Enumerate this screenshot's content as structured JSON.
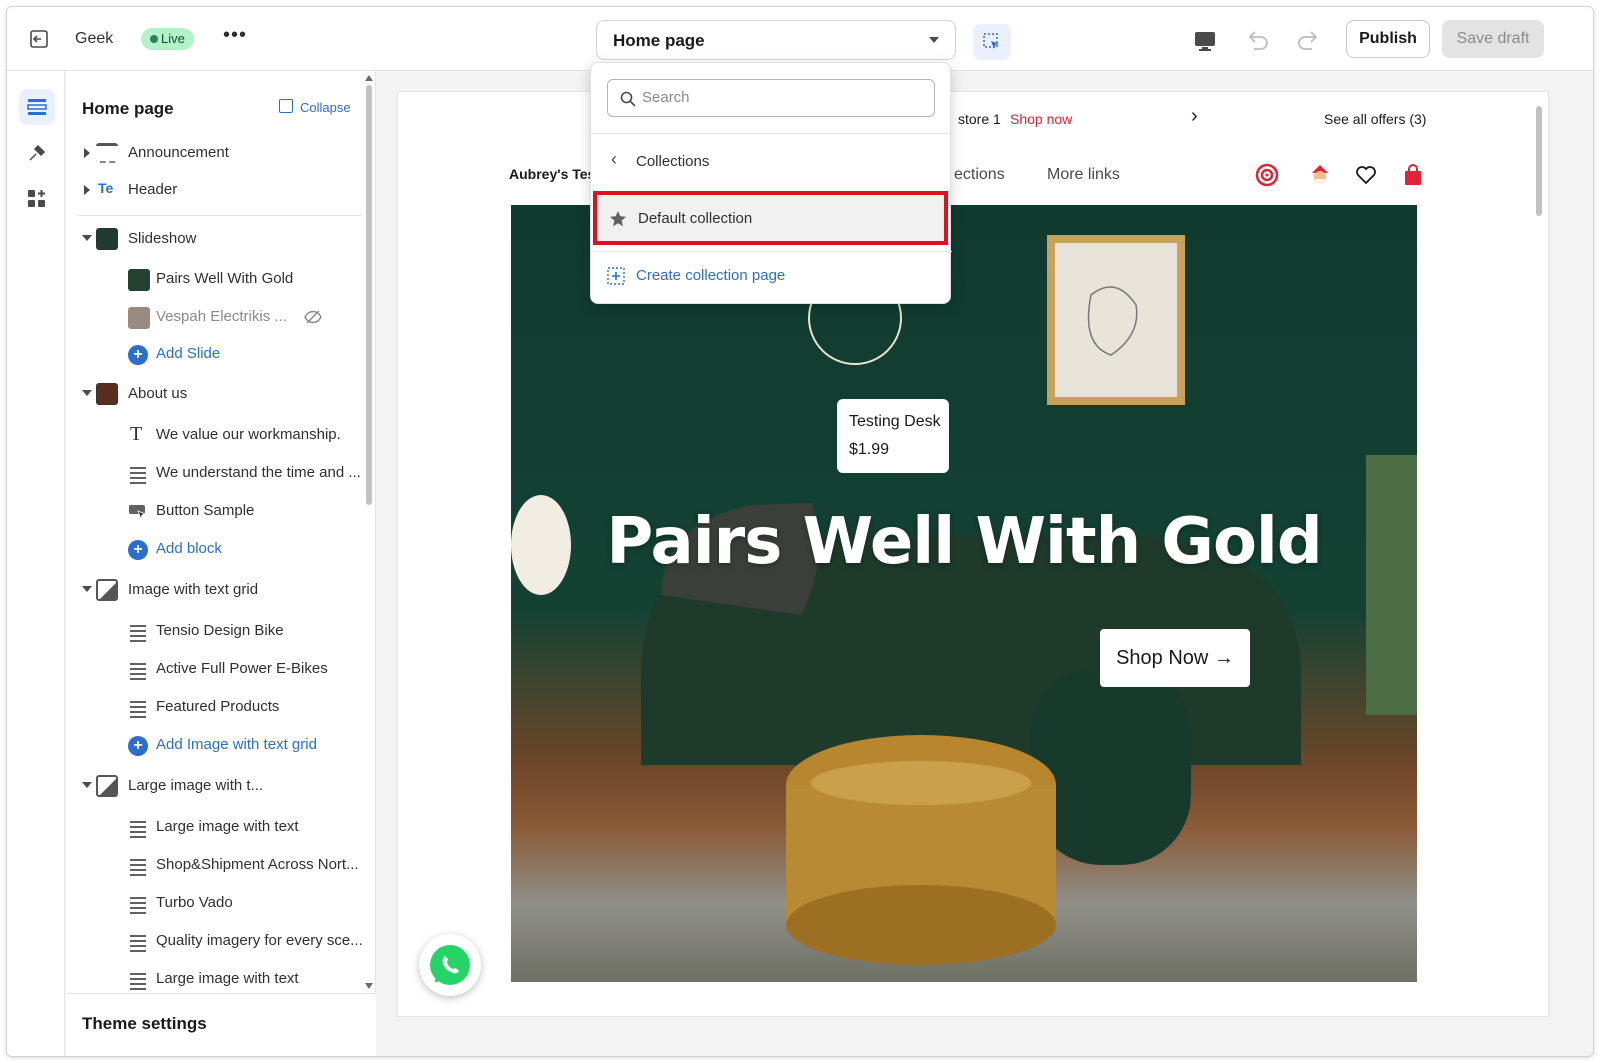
{
  "topbar": {
    "store_name": "Geek",
    "status_badge": "Live",
    "more_label": "•••",
    "page_selector": "Home page",
    "publish_label": "Publish",
    "save_draft_label": "Save draft"
  },
  "sidebar": {
    "title": "Home page",
    "collapse_label": "Collapse",
    "sections": [
      {
        "label": "Announcement"
      },
      {
        "label": "Header"
      },
      {
        "label": "Slideshow",
        "children": [
          "Pairs Well With Gold",
          "Vespah Electrikis ...",
          "Add Slide"
        ]
      },
      {
        "label": "About us",
        "children": [
          "We value our workmanship.",
          "We understand the time and ...",
          "Button Sample",
          "Add block"
        ]
      },
      {
        "label": "Image with text grid",
        "children": [
          "Tensio Design Bike",
          "Active Full Power E-Bikes",
          "Featured Products",
          "Add Image with text grid"
        ]
      },
      {
        "label": "Large image with t...",
        "children": [
          "Large image with text",
          "Shop&Shipment Across Nort...",
          "Turbo Vado",
          "Quality imagery for every sce...",
          "Large image with text"
        ]
      }
    ],
    "footer_label": "Theme settings"
  },
  "preview": {
    "announcement_text": "store 1",
    "announcement_link": "Shop now",
    "next_arrow": "›",
    "offers_link": "See all offers (3)",
    "store_logo_text": "Aubrey's Tes",
    "nav_items": [
      "ections",
      "More links"
    ],
    "hero_title": "Pairs Well With Gold",
    "hero_button": "Shop Now →",
    "product_tag_name": "Testing Desk",
    "product_tag_price": "$1.99"
  },
  "dropdown": {
    "search_placeholder": "Search",
    "back_label": "Collections",
    "selected_item": "Default collection",
    "create_label": "Create collection page"
  },
  "colors": {
    "accent": "#2c6ecb",
    "highlight": "#e0101c",
    "announcement_link": "#e0223a",
    "live_badge": "#b4f0c8"
  }
}
